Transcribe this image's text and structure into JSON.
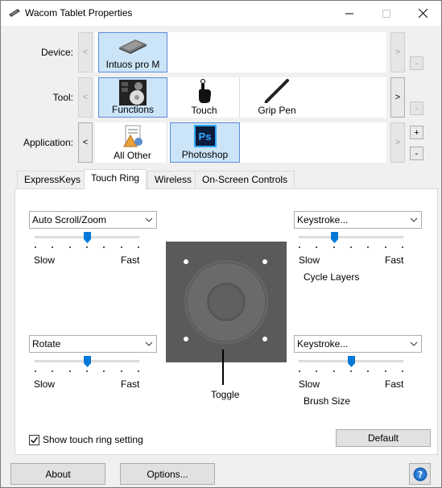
{
  "window": {
    "title": "Wacom Tablet Properties"
  },
  "rows": {
    "device": {
      "label": "Device:",
      "items": [
        {
          "label": "Intuos pro M"
        }
      ]
    },
    "tool": {
      "label": "Tool:",
      "items": [
        {
          "label": "Functions"
        },
        {
          "label": "Touch"
        },
        {
          "label": "Grip Pen"
        }
      ]
    },
    "application": {
      "label": "Application:",
      "items": [
        {
          "label": "All Other"
        },
        {
          "label": "Photoshop"
        }
      ]
    }
  },
  "nav": {
    "left": "<",
    "right": ">",
    "plus": "+",
    "minus": "-"
  },
  "tabs": [
    {
      "label": "ExpressKeys"
    },
    {
      "label": "Touch Ring"
    },
    {
      "label": "Wireless"
    },
    {
      "label": "On-Screen Controls"
    }
  ],
  "touch_ring": {
    "top_left": {
      "mode": "Auto Scroll/Zoom",
      "slow": "Slow",
      "fast": "Fast",
      "level": 0.5
    },
    "bottom_left": {
      "mode": "Rotate",
      "slow": "Slow",
      "fast": "Fast",
      "level": 0.5
    },
    "top_right": {
      "mode": "Keystroke...",
      "slow": "Slow",
      "fast": "Fast",
      "level": 0.33,
      "function": "Cycle Layers"
    },
    "bottom_right": {
      "mode": "Keystroke...",
      "slow": "Slow",
      "fast": "Fast",
      "level": 0.5,
      "function": "Brush Size"
    },
    "toggle_label": "Toggle",
    "show_setting_label": "Show touch ring setting",
    "show_setting_checked": true,
    "default_button": "Default"
  },
  "footer": {
    "about": "About",
    "options": "Options...",
    "help_icon": "question-icon"
  },
  "colors": {
    "selected_bg": "#cce4f7",
    "selected_border": "#5b8bd8",
    "slider_thumb": "#0078d7"
  }
}
